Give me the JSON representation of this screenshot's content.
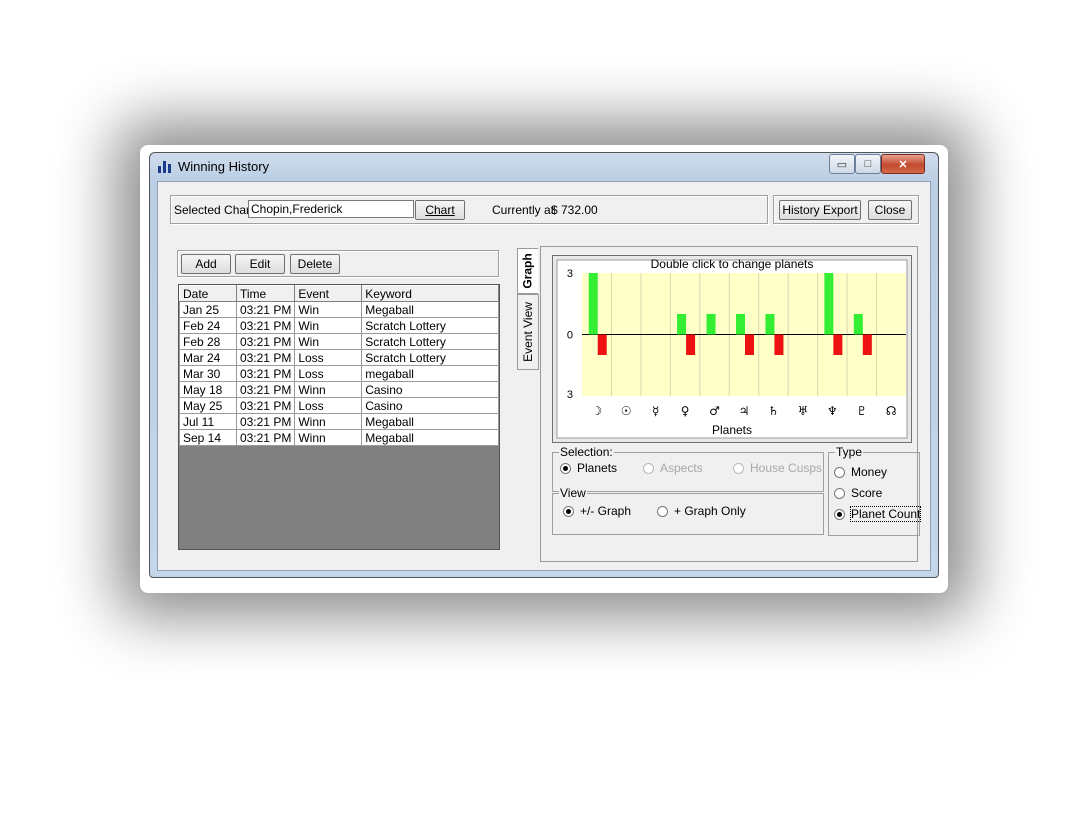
{
  "window": {
    "title": "Winning History",
    "min_glyph": "▭",
    "max_glyph": "□",
    "close_glyph": "✕"
  },
  "header": {
    "selected_chart_label": "Selected Chart",
    "selected_chart_value": "Chopin,Frederick",
    "chart_button": "Chart",
    "currently_at_label": "Currently at",
    "currently_at_value": "$ 732.00",
    "history_export_button": "History Export",
    "close_button": "Close"
  },
  "toolbar": {
    "add": "Add",
    "edit": "Edit",
    "delete": "Delete"
  },
  "table": {
    "columns": [
      "Date",
      "Time",
      "Event",
      "Keyword"
    ],
    "rows": [
      [
        "Jan 25",
        "03:21 PM",
        "Win",
        "Megaball"
      ],
      [
        "Feb 24",
        "03:21 PM",
        "Win",
        "Scratch Lottery"
      ],
      [
        "Feb 28",
        "03:21 PM",
        "Win",
        "Scratch Lottery"
      ],
      [
        "Mar 24",
        "03:21 PM",
        "Loss",
        "Scratch Lottery"
      ],
      [
        "Mar 30",
        "03:21 PM",
        "Loss",
        "megaball"
      ],
      [
        "May 18",
        "03:21 PM",
        "Winn",
        "Casino"
      ],
      [
        "May 25",
        "03:21 PM",
        "Loss",
        "Casino"
      ],
      [
        "Jul 11",
        "03:21 PM",
        "Winn",
        "Megaball"
      ],
      [
        "Sep 14",
        "03:21 PM",
        "Winn",
        "Megaball"
      ]
    ]
  },
  "tabs": {
    "graph": "Graph",
    "event_view": "Event View"
  },
  "colors": {
    "positive": "#33ee33",
    "negative": "#ee1111",
    "plot_bg": "#ffffc8",
    "grid": "#d8d8b0"
  },
  "chart_data": {
    "type": "bar",
    "title": "Double  click  to  change  planets",
    "xlabel": "Planets",
    "categories": [
      "☽",
      "☉",
      "☿",
      "♀",
      "♂",
      "♃",
      "♄",
      "♅",
      "♆",
      "♇",
      "☊"
    ],
    "series": [
      {
        "values": [
          3,
          0,
          0,
          1,
          1,
          1,
          1,
          0,
          3,
          1,
          0
        ]
      },
      {
        "values": [
          -1,
          0,
          0,
          -1,
          0,
          -1,
          -1,
          0,
          -1,
          -1,
          0
        ]
      }
    ],
    "yticks": [
      "3",
      "0",
      "3"
    ],
    "ylim": [
      -3,
      3
    ],
    "grid": true
  },
  "selection": {
    "legend": "Selection:",
    "options": [
      {
        "label": "Planets",
        "checked": true,
        "enabled": true
      },
      {
        "label": "Aspects",
        "checked": false,
        "enabled": false
      },
      {
        "label": "House Cusps",
        "checked": false,
        "enabled": false
      }
    ]
  },
  "view": {
    "legend": "View",
    "options": [
      {
        "label": "+/- Graph",
        "checked": true
      },
      {
        "label": "+ Graph Only",
        "checked": false
      }
    ]
  },
  "type": {
    "legend": "Type",
    "options": [
      {
        "label": "Money",
        "checked": false
      },
      {
        "label": "Score",
        "checked": false
      },
      {
        "label": "Planet Count",
        "checked": true
      }
    ]
  }
}
